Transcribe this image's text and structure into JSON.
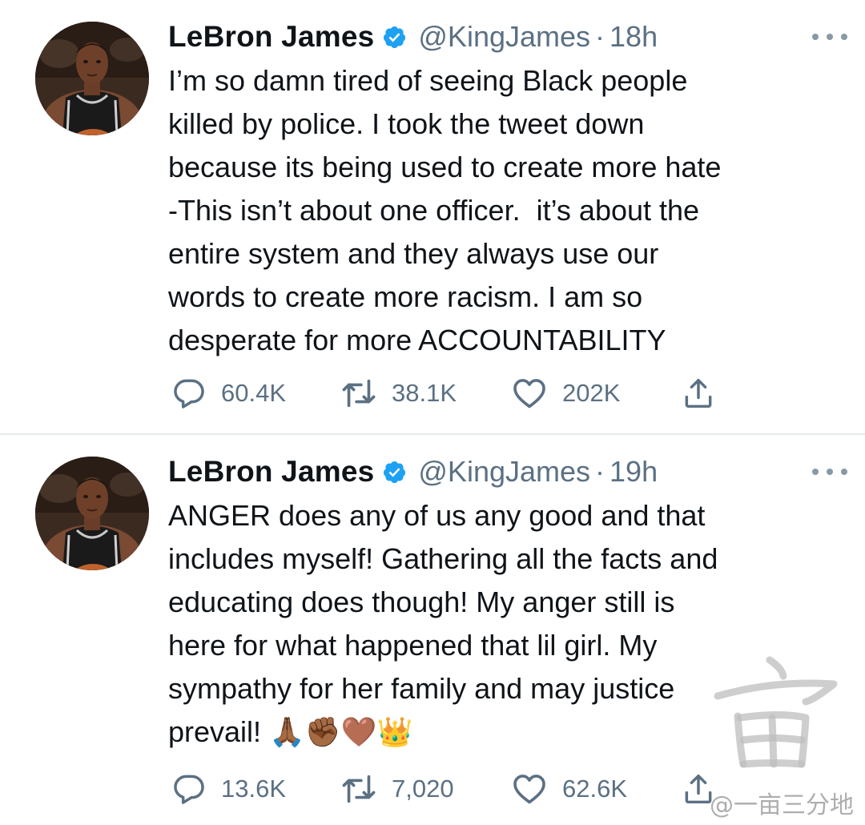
{
  "tweets": [
    {
      "author_name": "LeBron James",
      "handle": "@KingJames",
      "separator": "·",
      "time": "18h",
      "text": "I’m so damn tired of seeing Black people\nkilled by police. I took the tweet down\nbecause its being used to create more hate\n-This isn’t about one officer.  it’s about the\nentire system and they always use our\nwords to create more racism. I am so\ndesperate for more ACCOUNTABILITY",
      "replies": "60.4K",
      "retweets": "38.1K",
      "likes": "202K"
    },
    {
      "author_name": "LeBron James",
      "handle": "@KingJames",
      "separator": "·",
      "time": "19h",
      "text": "ANGER does any of us any good and that\nincludes myself! Gathering all the facts and\neducating does though! My anger still is\nhere for what happened that lil girl. My\nsympathy for her family and may justice\nprevail! 🙏🏾✊🏾🤎👑",
      "replies": "13.6K",
      "retweets": "7,020",
      "likes": "62.6K"
    }
  ],
  "icons": {
    "verified": "verified-badge-icon",
    "more": "more-options-icon",
    "reply": "reply-icon",
    "retweet": "retweet-icon",
    "like": "like-icon",
    "share": "share-icon"
  },
  "colors": {
    "verified_blue": "#1da1f2",
    "secondary_text": "#5b7083",
    "primary_text": "#0f1419",
    "divider": "#e6e9eb"
  },
  "watermark": {
    "text": "@一亩三分地"
  }
}
